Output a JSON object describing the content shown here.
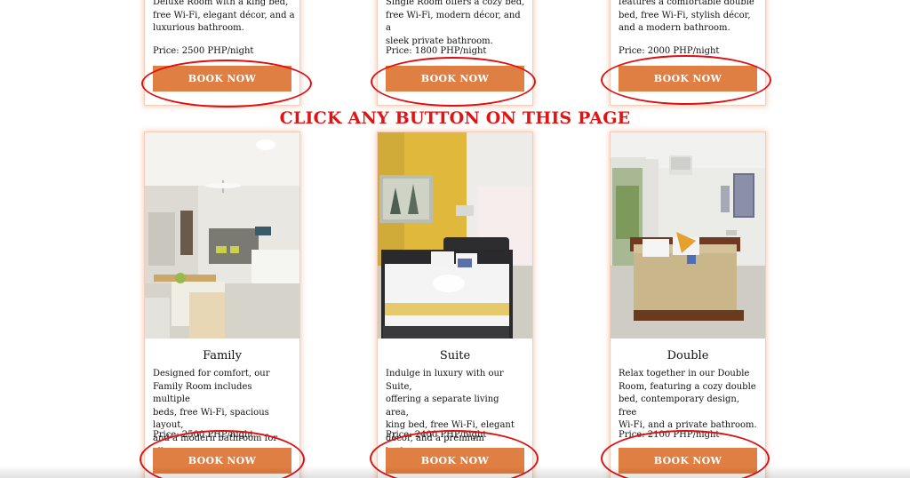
{
  "banner": "CLICK  ANY BUTTON ON THIS PAGE",
  "top_cards": [
    {
      "desc_lines": [
        "Deluxe Room with a king bed,",
        "free Wi-Fi, elegant décor, and a",
        "luxurious bathroom."
      ],
      "price": "Price: 2500 PHP/night",
      "button": "BOOK NOW"
    },
    {
      "desc_lines": [
        "Single Room offers a cozy bed,",
        "free Wi-Fi, modern décor, and a",
        "sleek private bathroom."
      ],
      "price": "Price: 1800 PHP/night",
      "button": "BOOK NOW"
    },
    {
      "desc_lines": [
        "features a comfortable double",
        "bed, free Wi-Fi, stylish décor,",
        "and a modern bathroom."
      ],
      "price": "Price: 2000 PHP/night",
      "button": "BOOK NOW"
    }
  ],
  "bottom_cards": [
    {
      "title": "Family",
      "desc_lines": [
        "Designed for comfort, our",
        "Family Room includes multiple",
        "beds, free Wi-Fi, spacious layout,",
        "and a modern bathroom for all."
      ],
      "price": "Price: 2500 PHP/night",
      "button": "BOOK NOW"
    },
    {
      "title": "Suite",
      "desc_lines": [
        "Indulge in luxury with our Suite,",
        "offering a separate living area,",
        "king bed, free Wi-Fi, elegant",
        "décor, and a premium bathroom."
      ],
      "price": "Price: 2400 PHP/night",
      "button": "BOOK NOW"
    },
    {
      "title": "Double",
      "desc_lines": [
        "Relax together in our Double",
        "Room, featuring a cozy double",
        "bed, contemporary design, free",
        "Wi-Fi, and a private bathroom."
      ],
      "price": "Price: 2100 PHP/night",
      "button": "BOOK NOW"
    }
  ],
  "colors": {
    "button": "#e07f43",
    "annotation": "#e01414",
    "card_glow": "#f3cdb9"
  }
}
